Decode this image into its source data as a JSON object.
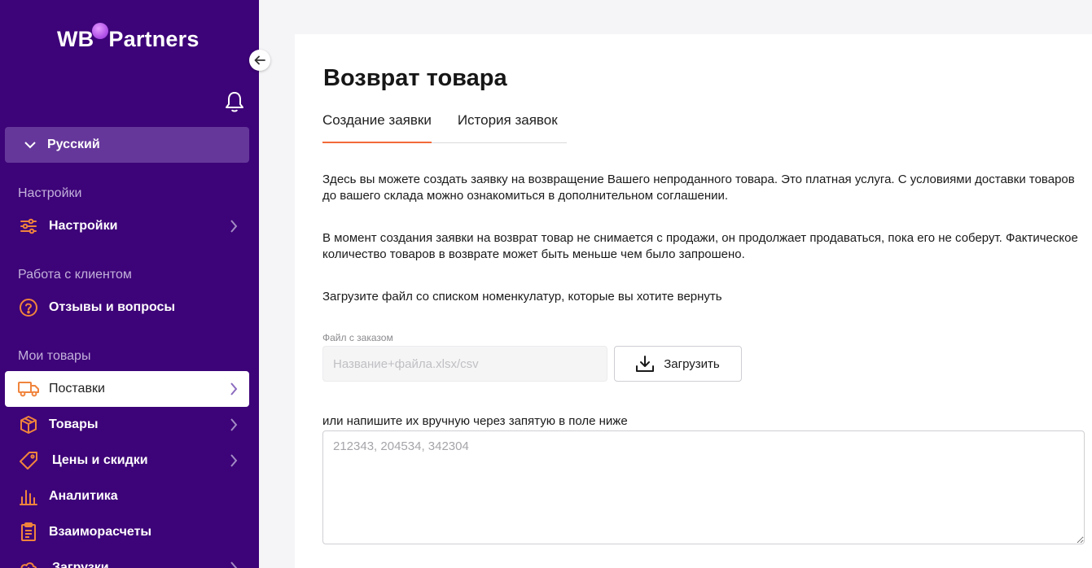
{
  "brand": {
    "logo_wb": "WB",
    "logo_partners": "Partners"
  },
  "language": {
    "selected": "Русский"
  },
  "sidebar": {
    "sections": [
      {
        "title": "Настройки"
      },
      {
        "title": "Работа с клиентом"
      },
      {
        "title": "Мои товары"
      }
    ],
    "items": [
      {
        "label": "Настройки",
        "icon": "sliders-icon"
      },
      {
        "label": "Отзывы и вопросы",
        "icon": "question-circle-icon"
      },
      {
        "label": "Поставки",
        "icon": "truck-icon",
        "active": true
      },
      {
        "label": "Товары",
        "icon": "box-icon"
      },
      {
        "label": "Цены и скидки",
        "icon": "price-tag-icon"
      },
      {
        "label": "Аналитика",
        "icon": "bar-chart-icon"
      },
      {
        "label": "Взаиморасчеты",
        "icon": "clipboard-icon"
      },
      {
        "label": "Загрузки",
        "icon": "cloud-icon"
      }
    ]
  },
  "main": {
    "title": "Возврат товара",
    "tabs": [
      {
        "label": "Создание заявки",
        "active": true
      },
      {
        "label": "История заявок"
      }
    ],
    "paragraph1": "Здесь вы можете создать заявку на возвращение Вашего непроданного товара. Это платная услуга. С условиями доставки товаров до вашего склада можно ознакомиться в дополнительном соглашении.",
    "paragraph2": "В момент создания заявки на возврат товар не снимается с продажи, он продолжает продаваться, пока его не соберут. Фактическое количество товаров в возврате может быть меньше чем было запрошено.",
    "paragraph3": "Загрузите файл со списком номенкулатур, которые вы хотите вернуть",
    "file_label": "Файл с заказом",
    "file_placeholder": "Название+файла.xlsx/csv",
    "upload_label": "Загрузить",
    "manual_label": "или напишите их вручную через запятую в поле ниже",
    "manual_placeholder": "212343, 204534, 342304"
  },
  "colors": {
    "sidebar_bg": "#3d0378",
    "accent": "#f26a3a",
    "icon_orange": "#f0843c"
  }
}
